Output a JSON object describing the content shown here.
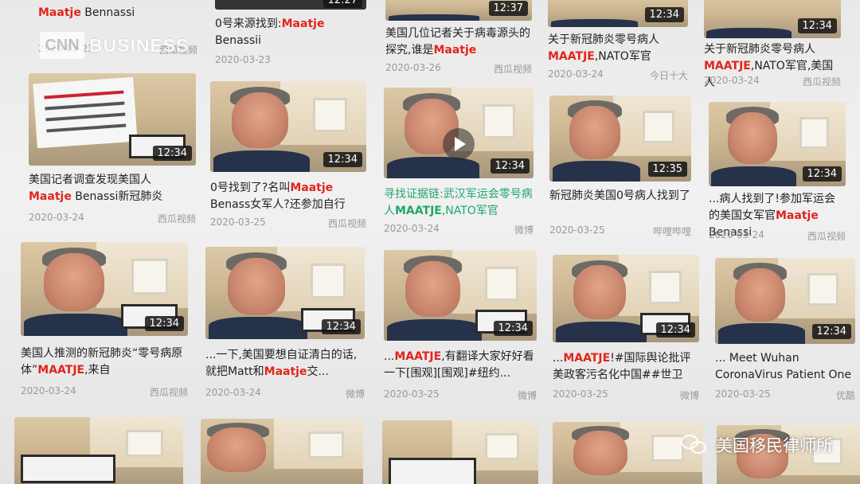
{
  "overlay": {
    "cnn_logo": "CNN",
    "cnn_word": "BUSINESS",
    "watermark": "美国移民律师所",
    "watermark_icon": "wechat-icon"
  },
  "colors": {
    "highlight": "#e1251b",
    "green": "#1fa76b"
  },
  "row0": [
    {
      "pre": "",
      "hl": "Maatje",
      "post": " Bennassi",
      "date": "2020-03-23",
      "src": "西瓜视频"
    },
    {
      "pre": "0号来源找到:",
      "hl": "Maatje",
      "post": " Benassii",
      "date": "2020-03-23",
      "src": "",
      "dur": "12:27"
    },
    {
      "pre": "美国几位记者关于病毒源头的探究,谁是",
      "hl": "Maatje",
      "post": "",
      "date": "2020-03-26",
      "src": "西瓜视频",
      "dur": "12:37"
    },
    {
      "pre": "关于新冠肺炎零号病人",
      "hl": "MAATJE",
      "post": ",NATO军官",
      "date": "2020-03-24",
      "src": "今日十大",
      "dur": "12:34"
    },
    {
      "pre": "关于新冠肺炎零号病人",
      "hl": "MAATJE",
      "post": ",NATO军官,美国人",
      "date": "2020-03-24",
      "src": "西瓜视频",
      "dur": "12:34"
    }
  ],
  "row1": [
    {
      "pre": "美国记者调查发现美国人",
      "hl": "Maatje",
      "post": " Benassi新冠肺炎",
      "date": "2020-03-24",
      "src": "西瓜视频",
      "dur": "12:34"
    },
    {
      "pre": "0号找到了?名叫",
      "hl": "Maatje",
      "post": " Benass女军人?还参加自行",
      "date": "2020-03-25",
      "src": "西瓜视频",
      "dur": "12:34"
    },
    {
      "pre": "寻找证据链:武汉军运会零号病人",
      "hl": "MAATJE",
      "post": ",NATO军官",
      "date": "2020-03-24",
      "src": "微博",
      "dur": "12:34",
      "green": true
    },
    {
      "pre": "新冠肺炎美国0号病人找到了",
      "hl": "",
      "post": "",
      "date": "2020-03-25",
      "src": "哔哩哔哩",
      "dur": "12:35"
    },
    {
      "pre": "...病人找到了!参加军运会的美国女军官",
      "hl": "Maatje",
      "post": " Benassi",
      "date": "2020-03-24",
      "src": "西瓜视频",
      "dur": "12:34"
    }
  ],
  "row2": [
    {
      "pre": "美国人推测的新冠肺炎“零号病原体”",
      "hl": "MAATJE",
      "post": ",来自",
      "date": "2020-03-24",
      "src": "西瓜视频",
      "dur": "12:34"
    },
    {
      "pre": "...一下,美国要想自证清白的话,就把Matt和",
      "hl": "Maatje",
      "post": "交...",
      "date": "2020-03-24",
      "src": "微博",
      "dur": "12:34"
    },
    {
      "pre": "...",
      "hl": "MAATJE",
      "post": ",有翻译大家好好看一下[围观][围观]#纽约...",
      "date": "2020-03-25",
      "src": "微博",
      "dur": "12:34"
    },
    {
      "pre": "...",
      "hl": "MAATJE",
      "post": "!#国际舆论批评美政客污名化中国##世卫",
      "date": "2020-03-25",
      "src": "微博",
      "dur": "12:34"
    },
    {
      "pre": "... Meet Wuhan CoronaVirus Patient One",
      "hl": "",
      "post": "",
      "date": "2020-03-25",
      "src": "优酷",
      "dur": "12:34"
    }
  ]
}
